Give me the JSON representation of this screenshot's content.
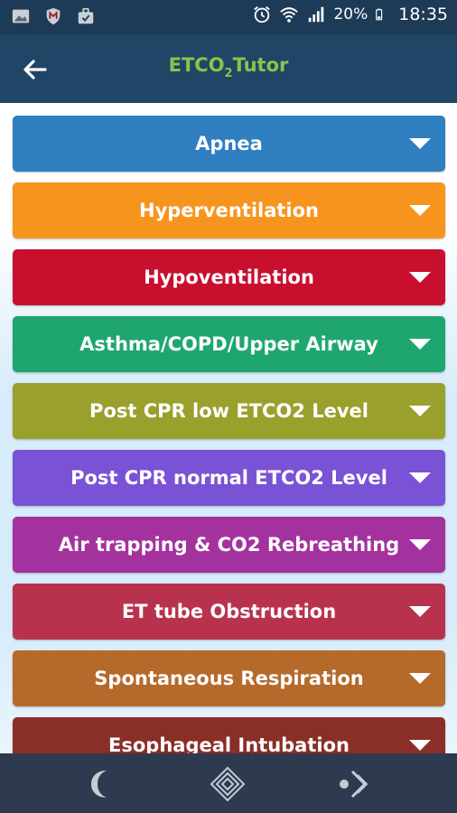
{
  "status_bar": {
    "battery_percent": "20%",
    "time": "18:35",
    "left_icons": [
      "image-icon",
      "mcafee-shield-icon",
      "briefcase-check-icon"
    ],
    "right_icons": [
      "alarm-clock-icon",
      "wifi-icon",
      "signal-icon",
      "battery-icon"
    ]
  },
  "app_bar": {
    "title_main": "ETCO",
    "title_subscript": "2",
    "title_tail": "Tutor",
    "title_color": "#8bc34a",
    "back_icon": "arrow-left-icon"
  },
  "accordion": {
    "items": [
      {
        "label": "Apnea",
        "color": "#2f7fc1"
      },
      {
        "label": "Hyperventilation",
        "color": "#f7941e"
      },
      {
        "label": "Hypoventilation",
        "color": "#c8102e"
      },
      {
        "label": "Asthma/COPD/Upper Airway",
        "color": "#1fa66f"
      },
      {
        "label": "Post CPR low ETCO2 Level",
        "color": "#9aa02c"
      },
      {
        "label": "Post CPR normal ETCO2 Level",
        "color": "#7a52d6"
      },
      {
        "label": "Air trapping & CO2 Rebreathing",
        "color": "#a4329e"
      },
      {
        "label": "ET tube Obstruction",
        "color": "#b8324e"
      },
      {
        "label": "Spontaneous Respiration",
        "color": "#b5692b"
      },
      {
        "label": "Esophageal Intubation",
        "color": "#8a2e28"
      }
    ],
    "caret_icon": "caret-down-icon"
  },
  "bottom_nav": {
    "icons": [
      "moon-icon",
      "diamond-icon",
      "dot-arrow-icon"
    ]
  }
}
